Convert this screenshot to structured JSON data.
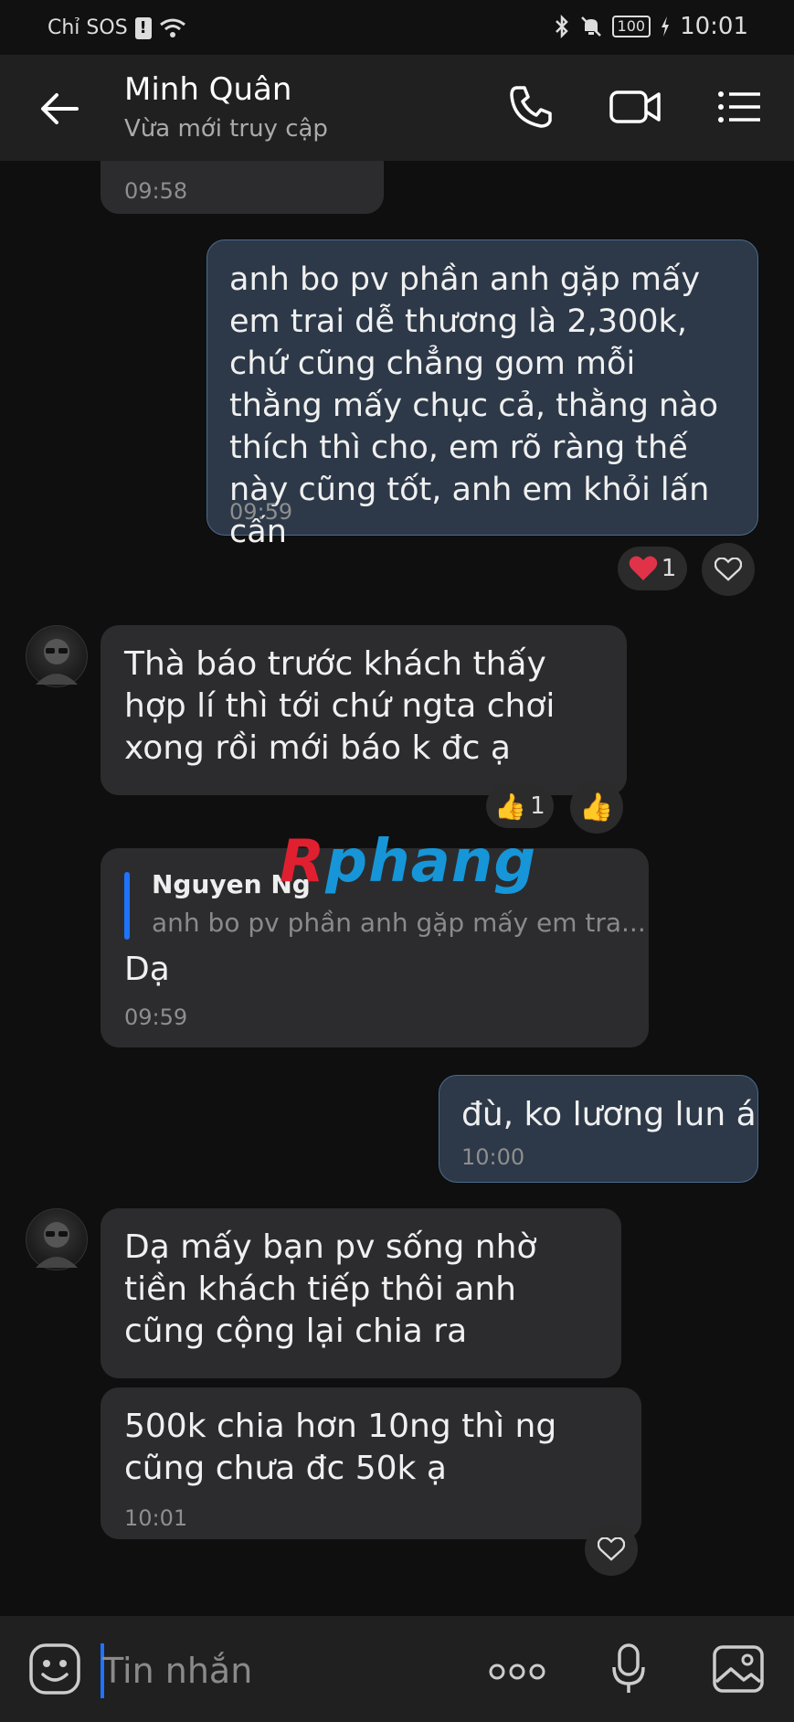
{
  "status_bar": {
    "carrier": "Chỉ SOS",
    "battery": "100",
    "time": "10:01"
  },
  "header": {
    "title": "Minh Quân",
    "subtitle": "Vừa mới truy cập"
  },
  "messages": {
    "m0": {
      "time": "09:58"
    },
    "m1": {
      "text": "anh bo pv phần anh gặp mấy em trai dễ thương là 2,300k, chứ cũng chẳng gom mỗi thằng mấy chục cả, thằng nào thích thì cho, em rõ ràng thế này cũng tốt, anh em khỏi lấn cấn",
      "time": "09:59",
      "reaction_count": "1"
    },
    "m2": {
      "text": "Thà báo trước khách thấy hợp lí thì tới chứ ngta chơi xong rồi mới báo k đc ạ",
      "reaction_count": "1"
    },
    "m3": {
      "quote_author": "Nguyen Ng",
      "quote_text": "anh bo pv phần anh gặp mấy em tra...",
      "text": "Dạ",
      "time": "09:59"
    },
    "m4": {
      "text": "đù, ko lương lun á",
      "time": "10:00"
    },
    "m5": {
      "text": "Dạ mấy bạn pv sống nhờ tiền khách tiếp thôi anh cũng cộng lại chia ra"
    },
    "m6": {
      "text": "500k chia hơn 10ng thì ng cũng chưa đc 50k ạ",
      "time": "10:01"
    }
  },
  "watermark": {
    "part1": "R",
    "part2": "phang"
  },
  "composer": {
    "placeholder": "Tin nhắn"
  },
  "colors": {
    "outgoing_bubble": "#2d3948",
    "incoming_bubble": "#2c2c2e",
    "accent": "#1e74ff"
  }
}
